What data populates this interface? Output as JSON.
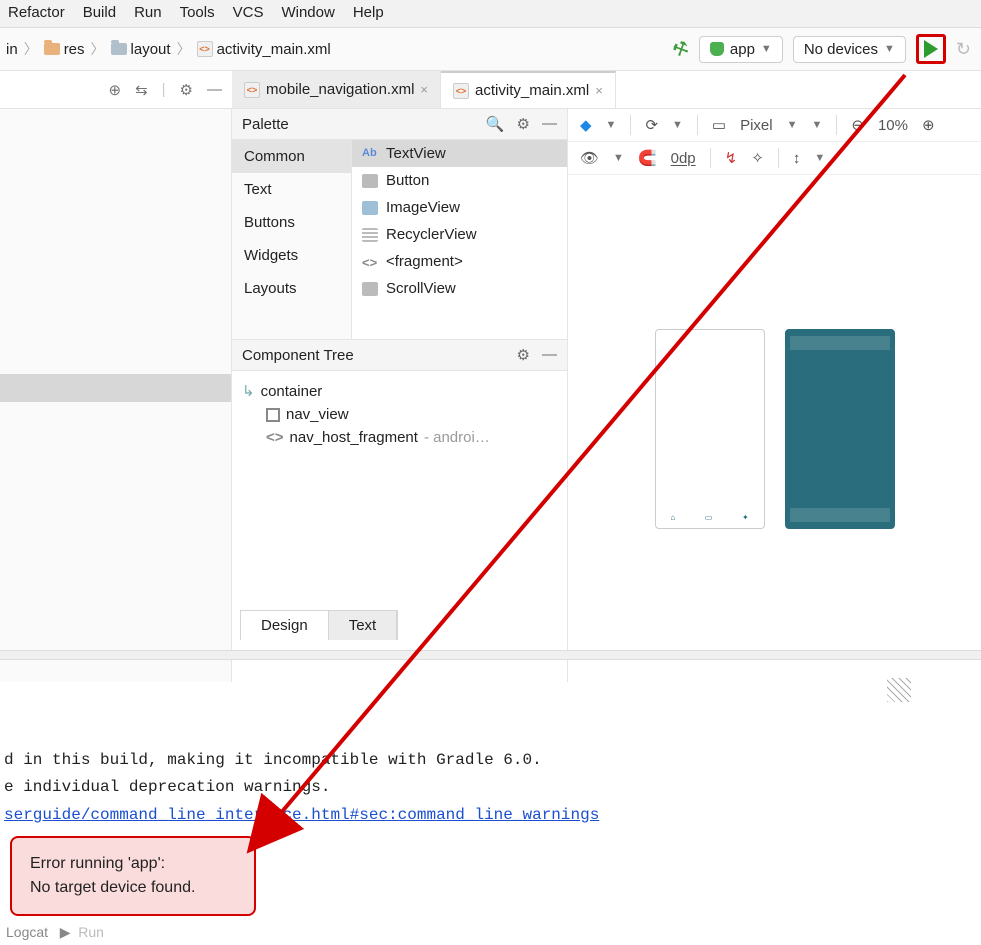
{
  "menu": {
    "items": [
      "Refactor",
      "Build",
      "Run",
      "Tools",
      "VCS",
      "Window",
      "Help"
    ]
  },
  "breadcrumbs": {
    "c0": "in",
    "c1": "res",
    "c2": "layout",
    "c3": "activity_main.xml"
  },
  "run": {
    "config": "app",
    "device": "No devices"
  },
  "toolbar_icons": {
    "target": "⊕",
    "collapse": "⇆",
    "settings": "⚙",
    "minimize": "—"
  },
  "tabs": {
    "t0": {
      "label": "mobile_navigation.xml"
    },
    "t1": {
      "label": "activity_main.xml"
    }
  },
  "palette": {
    "title": "Palette",
    "cats": [
      "Common",
      "Text",
      "Buttons",
      "Widgets",
      "Layouts"
    ],
    "items": [
      "TextView",
      "Button",
      "ImageView",
      "RecyclerView",
      "<fragment>",
      "ScrollView"
    ]
  },
  "tree": {
    "title": "Component Tree",
    "root": "container",
    "n1": "nav_view",
    "n2": "nav_host_fragment",
    "n2_hint": "- androi…"
  },
  "preview": {
    "device": "Pixel",
    "zoom": "10%",
    "margin": "0dp"
  },
  "bottom_tabs": {
    "design": "Design",
    "text": "Text"
  },
  "console": {
    "l1": "d in this build, making it incompatible with Gradle 6.0.",
    "l2": "e individual deprecation warnings.",
    "link": "serguide/command_line_interface.html#sec:command_line_warnings"
  },
  "error": {
    "l1": "Error running 'app':",
    "l2": "No target device found."
  },
  "status": {
    "logcat": "Logcat",
    "run": "Run"
  }
}
